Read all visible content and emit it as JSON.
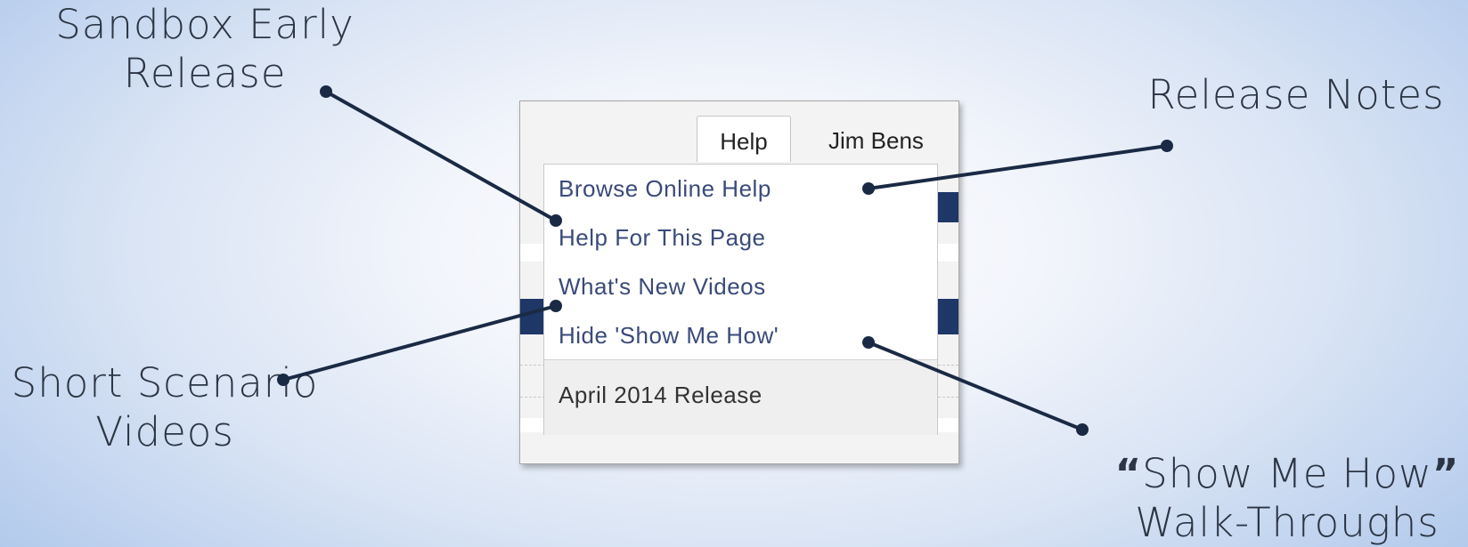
{
  "callouts": {
    "sandbox_line1": "Sandbox Early",
    "sandbox_line2": "Release",
    "release_notes": "Release Notes",
    "short_line1": "Short Scenario",
    "short_line2": "Videos",
    "showme_open_quote": "“",
    "showme_text": "Show Me How",
    "showme_close_quote": "”",
    "showme_line2": "Walk-Throughs"
  },
  "tabs": {
    "help": "Help",
    "user": "Jim Bens"
  },
  "help_menu": {
    "items": [
      "Browse Online Help",
      "Help For This Page",
      "What's New Videos",
      "Hide 'Show Me How'"
    ],
    "footer": "April 2014 Release"
  },
  "colors": {
    "connector": "#1a2a44",
    "menu_link": "#3a4a7a",
    "nav_bar": "#1e3766"
  }
}
